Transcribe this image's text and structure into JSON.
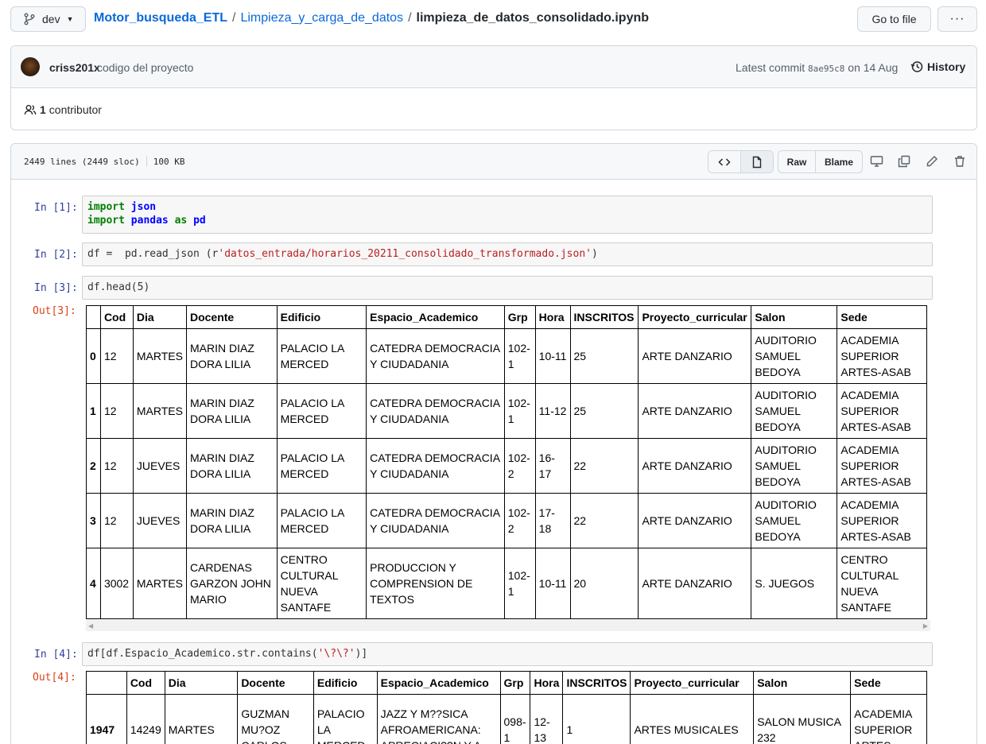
{
  "breadcrumb": {
    "branch": "dev",
    "repo": "Motor_busqueda_ETL",
    "folder": "Limpieza_y_carga_de_datos",
    "file": "limpieza_de_datos_consolidado.ipynb",
    "separator": "/"
  },
  "actions": {
    "goto_file": "Go to file",
    "more": "···"
  },
  "commit": {
    "author": "criss201x",
    "message": "codigo del proyecto",
    "latest_prefix": "Latest commit",
    "sha": "8ae95c8",
    "date": "on 14 Aug",
    "history": "History"
  },
  "contributors": {
    "count": "1",
    "label": "contributor"
  },
  "file_header": {
    "lines": "2449 lines (2449 sloc)",
    "size": "100 KB",
    "raw": "Raw",
    "blame": "Blame"
  },
  "notebook": {
    "cells": [
      {
        "prompt": "In [1]:"
      },
      {
        "prompt": "In [2]:",
        "code": "df =  pd.read_json (r'datos_entrada/horarios_20211_consolidado_transformado.json')"
      },
      {
        "prompt": "In [3]:",
        "code": "df.head(5)"
      },
      {
        "prompt": "In [4]:",
        "code": "df[df.Espacio_Academico.str.contains('\\?\\?')]"
      }
    ],
    "outputs": [
      "Out[3]:",
      "Out[4]:"
    ],
    "code1": {
      "kw1": "import",
      "mod1": "json",
      "kw2": "import",
      "mod2": "pandas",
      "as": "as",
      "alias": "pd"
    },
    "code2": {
      "lhs": "df =  pd.read_json (r",
      "str": "'datos_entrada/horarios_20211_consolidado_transformado.json'",
      "rhs": ")"
    },
    "code4": {
      "lhs": "df[df.Espacio_Academico.str.contains(",
      "str": "'\\?\\?'",
      "rhs": ")]"
    }
  },
  "table1": {
    "columns": [
      "",
      "Cod",
      "Dia",
      "Docente",
      "Edificio",
      "Espacio_Academico",
      "Grp",
      "Hora",
      "INSCRITOS",
      "Proyecto_curricular",
      "Salon",
      "Sede"
    ],
    "rows": [
      [
        "0",
        "12",
        "MARTES",
        "MARIN DIAZ DORA LILIA",
        "PALACIO LA MERCED",
        "CATEDRA DEMOCRACIA Y CIUDADANIA",
        "102-1",
        "10-11",
        "25",
        "ARTE DANZARIO",
        "AUDITORIO SAMUEL BEDOYA",
        "ACADEMIA SUPERIOR ARTES-ASAB"
      ],
      [
        "1",
        "12",
        "MARTES",
        "MARIN DIAZ DORA LILIA",
        "PALACIO LA MERCED",
        "CATEDRA DEMOCRACIA Y CIUDADANIA",
        "102-1",
        "11-12",
        "25",
        "ARTE DANZARIO",
        "AUDITORIO SAMUEL BEDOYA",
        "ACADEMIA SUPERIOR ARTES-ASAB"
      ],
      [
        "2",
        "12",
        "JUEVES",
        "MARIN DIAZ DORA LILIA",
        "PALACIO LA MERCED",
        "CATEDRA DEMOCRACIA Y CIUDADANIA",
        "102-2",
        "16-17",
        "22",
        "ARTE DANZARIO",
        "AUDITORIO SAMUEL BEDOYA",
        "ACADEMIA SUPERIOR ARTES-ASAB"
      ],
      [
        "3",
        "12",
        "JUEVES",
        "MARIN DIAZ DORA LILIA",
        "PALACIO LA MERCED",
        "CATEDRA DEMOCRACIA Y CIUDADANIA",
        "102-2",
        "17-18",
        "22",
        "ARTE DANZARIO",
        "AUDITORIO SAMUEL BEDOYA",
        "ACADEMIA SUPERIOR ARTES-ASAB"
      ],
      [
        "4",
        "3002",
        "MARTES",
        "CARDENAS GARZON JOHN MARIO",
        "CENTRO CULTURAL NUEVA SANTAFE",
        "PRODUCCION Y COMPRENSION DE TEXTOS",
        "102-1",
        "10-11",
        "20",
        "ARTE DANZARIO",
        "S. JUEGOS",
        "CENTRO CULTURAL NUEVA SANTAFE"
      ]
    ]
  },
  "table2": {
    "columns": [
      "",
      "Cod",
      "Dia",
      "Docente",
      "Edificio",
      "Espacio_Academico",
      "Grp",
      "Hora",
      "INSCRITOS",
      "Proyecto_curricular",
      "Salon",
      "Sede"
    ],
    "rows": [
      [
        "1947",
        "14249",
        "MARTES",
        "GUZMAN MU?OZ CARLOS",
        "PALACIO LA MERCED",
        "JAZZ Y M??SICA AFROAMERICANA: APRECIACI??N Y A",
        "098-1",
        "12-13",
        "1",
        "ARTES MUSICALES",
        "SALON MUSICA 232",
        "ACADEMIA SUPERIOR ARTES-"
      ]
    ]
  }
}
